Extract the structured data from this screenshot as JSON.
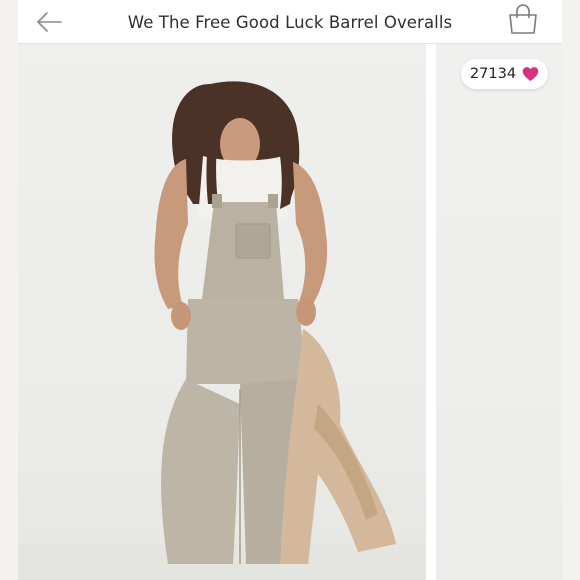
{
  "header": {
    "title": "We The Free Good Luck Barrel Overalls",
    "back_icon": "arrow-left-icon",
    "bag_icon": "shopping-bag-icon"
  },
  "likes": {
    "count": "27134",
    "icon": "heart-icon",
    "color": "#d6307f"
  },
  "product_image": {
    "alt": "Model wearing khaki denim barrel-leg overalls holding a tan jacket"
  }
}
